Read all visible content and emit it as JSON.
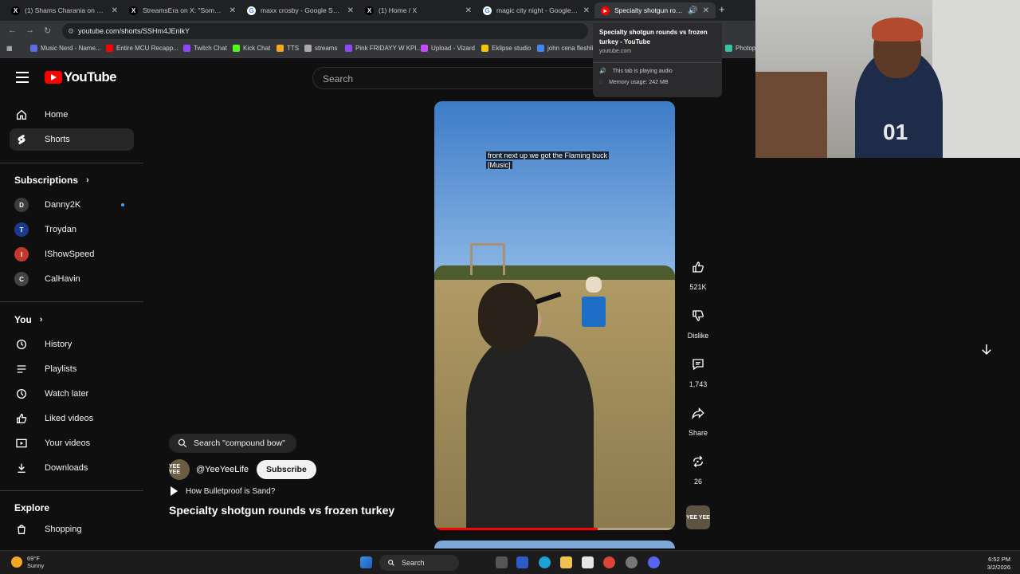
{
  "browser": {
    "tabs": [
      {
        "title": "(1) Shams Charania on X: \"Wa",
        "icon": "x-logo",
        "color": "#000000"
      },
      {
        "title": "StreamsEra on X: \"Some girls a",
        "icon": "x-logo",
        "color": "#000000"
      },
      {
        "title": "maxx crosby - Google Search",
        "icon": "google-logo",
        "color": "#4285f4"
      },
      {
        "title": "(1) Home / X",
        "icon": "x-logo",
        "color": "#000000"
      },
      {
        "title": "magic city night - Google Sear",
        "icon": "google-logo",
        "color": "#4285f4"
      },
      {
        "title": "Specialty shotgun rounds v",
        "icon": "youtube-logo",
        "color": "#ff0000"
      }
    ],
    "url": "youtube.com/shorts/SSHm4JEnlkY",
    "bookmarks": [
      {
        "label": "Music Nerd - Name...",
        "color": "#5b6ee1"
      },
      {
        "label": "Entire MCU Recapp...",
        "color": "#ff0000"
      },
      {
        "label": "Twitch Chat",
        "color": "#9146ff"
      },
      {
        "label": "Kick Chat",
        "color": "#53fc18"
      },
      {
        "label": "TTS",
        "color": "#f5a623"
      },
      {
        "label": "streams",
        "color": "#aaaaaa"
      },
      {
        "label": "Pink FRIDAYY W KPI...",
        "color": "#9146ff"
      },
      {
        "label": "Upload - Vizard",
        "color": "#c84cff"
      },
      {
        "label": "Eklipse studio",
        "color": "#f5c400"
      },
      {
        "label": "john cena fleshlig",
        "color": "#4285f4"
      },
      {
        "label": "Photop",
        "color": "#31c5a0"
      }
    ],
    "tooltip": {
      "title": "Specialty shotgun rounds vs frozen turkey - YouTube",
      "domain": "youtube.com",
      "audio": "This tab is playing audio",
      "memory": "Memory usage: 242 MB"
    }
  },
  "youtube": {
    "logo_text": "YouTube",
    "search_placeholder": "Search",
    "sidebar": {
      "main": [
        {
          "label": "Home",
          "icon": "home-icon"
        },
        {
          "label": "Shorts",
          "icon": "shorts-icon"
        }
      ],
      "subscriptions_label": "Subscriptions",
      "subscriptions": [
        {
          "label": "Danny2K",
          "color": "#3c3c3c",
          "live": true
        },
        {
          "label": "Troydan",
          "color": "#1a3b8c",
          "live": false
        },
        {
          "label": "IShowSpeed",
          "color": "#c0392b",
          "live": false
        },
        {
          "label": "CalHavin",
          "color": "#444444",
          "live": false
        }
      ],
      "you_label": "You",
      "you": [
        {
          "label": "History",
          "icon": "history-icon"
        },
        {
          "label": "Playlists",
          "icon": "playlists-icon"
        },
        {
          "label": "Watch later",
          "icon": "clock-icon"
        },
        {
          "label": "Liked videos",
          "icon": "thumbs-up-icon"
        },
        {
          "label": "Your videos",
          "icon": "your-videos-icon"
        },
        {
          "label": "Downloads",
          "icon": "download-icon"
        }
      ],
      "explore_label": "Explore",
      "explore": [
        {
          "label": "Shopping",
          "icon": "shopping-icon"
        }
      ]
    },
    "short": {
      "caption_line1": "front next up we got the Flaming buck",
      "caption_line2": "[Music]",
      "search_suggestion": "Search \"compound bow\"",
      "channel": "@YeeYeeLife",
      "channel_badge": "YEE YEE",
      "subscribe": "Subscribe",
      "related": "How Bulletproof is Sand?",
      "title": "Specialty shotgun rounds vs frozen turkey",
      "progress": 0.68,
      "likes": "521K",
      "dislike": "Dislike",
      "comments": "1,743",
      "share": "Share",
      "remix": "26"
    }
  },
  "webcam": {
    "jersey_number": "01"
  },
  "taskbar": {
    "temp": "69°F",
    "condition": "Sunny",
    "search": "Search",
    "time": "6:52 PM",
    "date": "3/2/2026"
  }
}
